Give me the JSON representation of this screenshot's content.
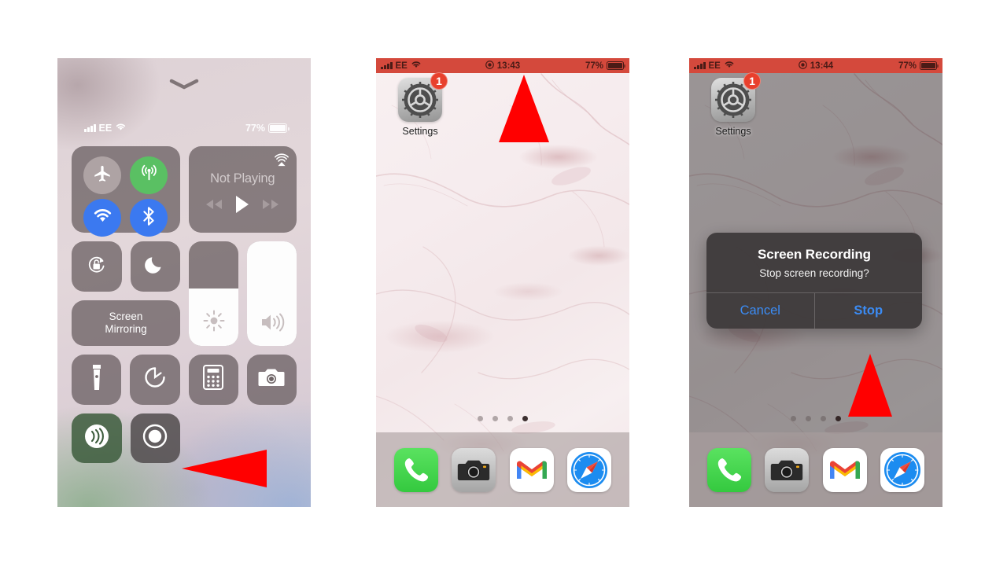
{
  "colors": {
    "recording_red": "#d4493c",
    "arrow_red": "#ff0000",
    "badge_red": "#e8402d",
    "ios_blue": "#3b8cf5",
    "toggle_green": "#5ac063",
    "toggle_blue": "#3b79f0"
  },
  "phone1": {
    "name": "control-center",
    "status": {
      "carrier": "EE",
      "signal_icon": "cellular-bars-icon",
      "wifi_icon": "wifi-icon",
      "battery_percent": "77%",
      "battery_icon": "battery-icon"
    },
    "handle_icon": "chevron-down-handle-icon",
    "connectivity": {
      "airplane": {
        "label": "Airplane Mode",
        "icon": "airplane-icon",
        "state": "off"
      },
      "cellular": {
        "label": "Cellular Data",
        "icon": "cellular-tower-icon",
        "state": "on"
      },
      "wifi": {
        "label": "Wi-Fi",
        "icon": "wifi-icon",
        "state": "on"
      },
      "bluetooth": {
        "label": "Bluetooth",
        "icon": "bluetooth-icon",
        "state": "on"
      }
    },
    "media": {
      "title": "Not Playing",
      "airplay_icon": "airplay-icon",
      "prev_icon": "rewind-icon",
      "play_icon": "play-icon",
      "next_icon": "fast-forward-icon"
    },
    "rotation_lock": {
      "label": "Rotation Lock",
      "icon": "rotation-lock-icon"
    },
    "do_not_disturb": {
      "label": "Do Not Disturb",
      "icon": "moon-icon"
    },
    "screen_mirroring": {
      "label": "Screen\nMirroring",
      "label_line1": "Screen",
      "label_line2": "Mirroring",
      "icon": "screen-mirroring-icon"
    },
    "brightness": {
      "label": "Brightness",
      "icon": "brightness-sun-icon",
      "value": 55
    },
    "volume": {
      "label": "Volume",
      "icon": "volume-icon",
      "value": 100
    },
    "shortcuts": [
      {
        "label": "Flashlight",
        "icon": "flashlight-icon"
      },
      {
        "label": "Timer",
        "icon": "timer-icon"
      },
      {
        "label": "Calculator",
        "icon": "calculator-icon"
      },
      {
        "label": "Camera",
        "icon": "camera-icon"
      },
      {
        "label": "Hearing",
        "icon": "hearing-icon",
        "state": "on"
      },
      {
        "label": "Screen Recording",
        "icon": "screen-record-icon"
      }
    ]
  },
  "phone2": {
    "name": "home-screen-recording",
    "status": {
      "carrier": "EE",
      "signal_icon": "cellular-bars-icon",
      "wifi_icon": "wifi-icon",
      "recording_icon": "recording-dot-icon",
      "time": "13:43",
      "battery_percent": "77%",
      "battery_icon": "battery-icon"
    },
    "app": {
      "label": "Settings",
      "icon": "settings-gear-icon",
      "badge": "1"
    },
    "page_dots": {
      "count": 4,
      "active_index": 3
    },
    "dock": [
      {
        "label": "Phone",
        "icon": "phone-icon"
      },
      {
        "label": "Camera",
        "icon": "camera-icon"
      },
      {
        "label": "Gmail",
        "icon": "gmail-icon"
      },
      {
        "label": "Safari",
        "icon": "safari-compass-icon"
      }
    ]
  },
  "phone3": {
    "name": "home-screen-stop-alert",
    "status": {
      "carrier": "EE",
      "signal_icon": "cellular-bars-icon",
      "wifi_icon": "wifi-icon",
      "recording_icon": "recording-dot-icon",
      "time": "13:44",
      "battery_percent": "77%",
      "battery_icon": "battery-icon"
    },
    "app": {
      "label": "Settings",
      "icon": "settings-gear-icon",
      "badge": "1"
    },
    "page_dots": {
      "count": 4,
      "active_index": 3
    },
    "dock": [
      {
        "label": "Phone",
        "icon": "phone-icon"
      },
      {
        "label": "Camera",
        "icon": "camera-icon"
      },
      {
        "label": "Gmail",
        "icon": "gmail-icon"
      },
      {
        "label": "Safari",
        "icon": "safari-compass-icon"
      }
    ],
    "alert": {
      "title": "Screen Recording",
      "message": "Stop screen recording?",
      "cancel_label": "Cancel",
      "stop_label": "Stop"
    }
  },
  "annotations": [
    {
      "name": "arrow-pointing-to-screen-record-toggle",
      "icon": "left-pointing-triangle-icon"
    },
    {
      "name": "arrow-pointing-to-status-bar",
      "icon": "up-pointing-triangle-icon"
    },
    {
      "name": "arrow-pointing-to-stop-button",
      "icon": "up-pointing-triangle-icon"
    }
  ]
}
